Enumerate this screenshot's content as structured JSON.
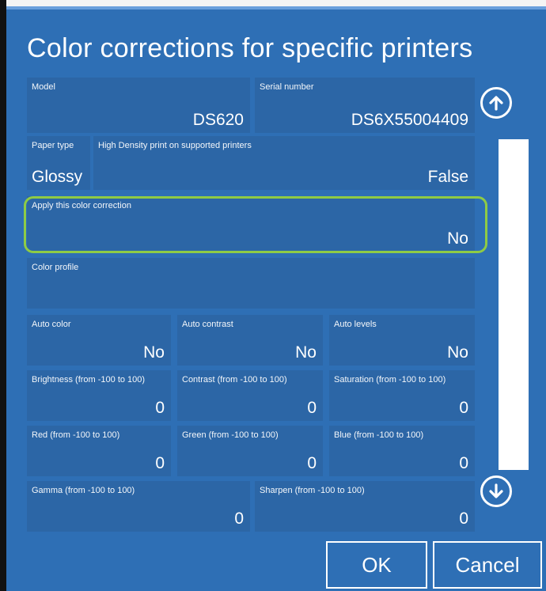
{
  "dialog": {
    "title": "Color corrections for specific printers"
  },
  "fields": {
    "model": {
      "label": "Model",
      "value": "DS620"
    },
    "serial": {
      "label": "Serial number",
      "value": "DS6X55004409"
    },
    "paper_type": {
      "label": "Paper type",
      "value": "Glossy"
    },
    "high_density": {
      "label": "High Density print on supported printers",
      "value": "False"
    },
    "apply_correction": {
      "label": "Apply this color correction",
      "value": "No"
    },
    "color_profile": {
      "label": "Color profile",
      "value": ""
    },
    "auto_color": {
      "label": "Auto color",
      "value": "No"
    },
    "auto_contrast": {
      "label": "Auto contrast",
      "value": "No"
    },
    "auto_levels": {
      "label": "Auto levels",
      "value": "No"
    },
    "brightness": {
      "label": "Brightness (from -100 to 100)",
      "value": "0"
    },
    "contrast": {
      "label": "Contrast (from -100 to 100)",
      "value": "0"
    },
    "saturation": {
      "label": "Saturation (from -100 to 100)",
      "value": "0"
    },
    "red": {
      "label": "Red (from -100 to 100)",
      "value": "0"
    },
    "green": {
      "label": "Green (from -100 to 100)",
      "value": "0"
    },
    "blue": {
      "label": "Blue (from -100 to 100)",
      "value": "0"
    },
    "gamma": {
      "label": "Gamma (from -100 to 100)",
      "value": "0"
    },
    "sharpen": {
      "label": "Sharpen (from -100 to 100)",
      "value": "0"
    }
  },
  "scroll": {
    "up_icon": "arrow-up-circle-icon",
    "down_icon": "arrow-down-circle-icon"
  },
  "buttons": {
    "ok": "OK",
    "cancel": "Cancel"
  },
  "colors": {
    "dialog_bg": "#2e6fb5",
    "cell_bg": "#2c66a6",
    "highlight": "#8ecb45",
    "text": "#ffffff"
  }
}
